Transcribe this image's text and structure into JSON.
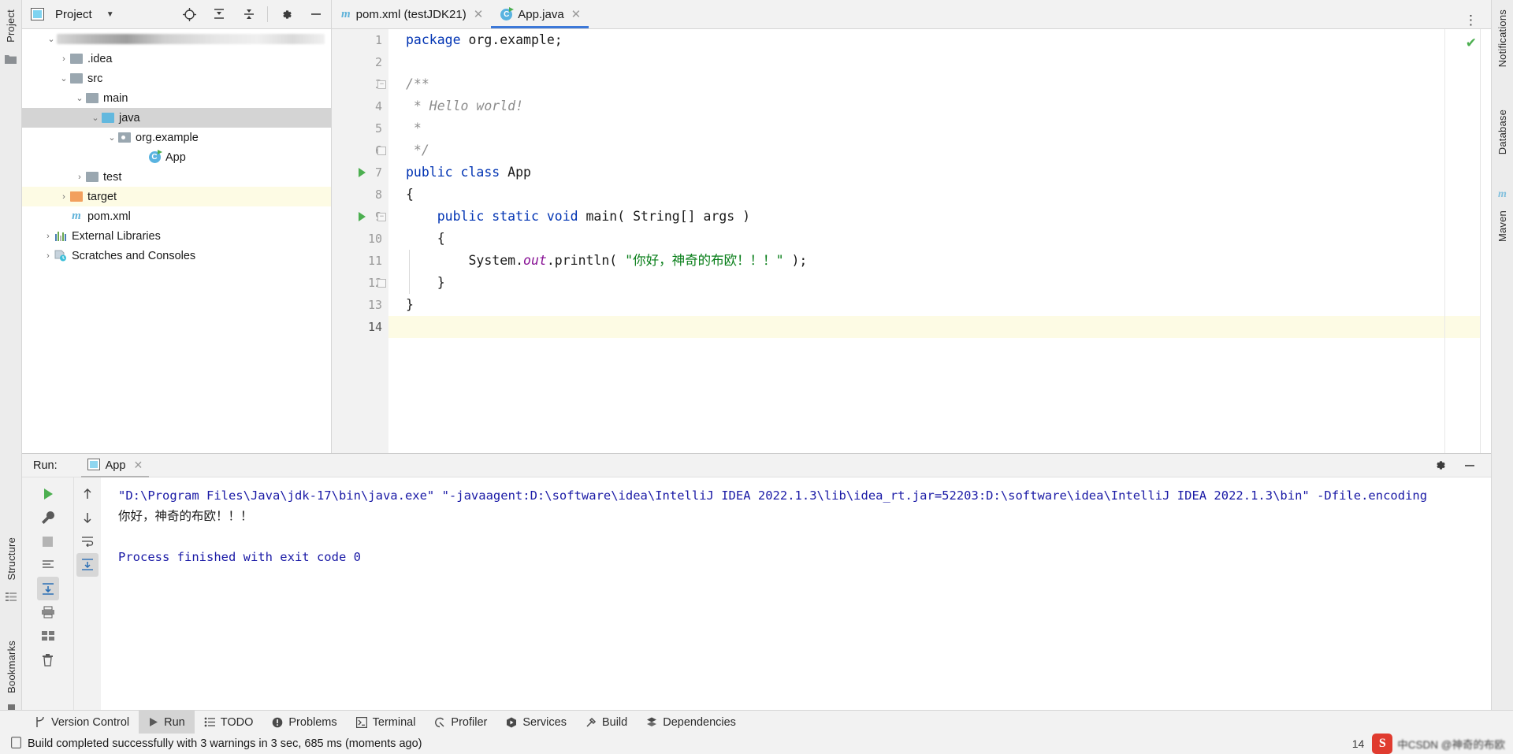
{
  "window": {
    "left_strip": {
      "project_tab": "Project",
      "structure_tab": "Structure",
      "bookmarks_tab": "Bookmarks"
    },
    "right_strip": {
      "notifications_tab": "Notifications",
      "database_tab": "Database",
      "maven_tab": "Maven"
    }
  },
  "project_toolbar": {
    "title": "Project",
    "icons": [
      "project-select-icon",
      "locate-icon",
      "expand-all-icon",
      "collapse-all-icon",
      "settings-gear-icon",
      "minimize-icon"
    ]
  },
  "editor_tabs": [
    {
      "label": "pom.xml (testJDK21)",
      "icon": "maven-file-icon",
      "active": false,
      "closable": true
    },
    {
      "label": "App.java",
      "icon": "java-class-icon",
      "active": true,
      "closable": true
    }
  ],
  "project_tree": [
    {
      "label": "",
      "indent": 0,
      "arrow": "down",
      "icon": "project-root-blurred",
      "blurred": true,
      "state": "normal"
    },
    {
      "label": ".idea",
      "indent": 1,
      "arrow": "right",
      "icon": "folder-gray",
      "state": "normal"
    },
    {
      "label": "src",
      "indent": 1,
      "arrow": "down",
      "icon": "folder-gray",
      "state": "normal"
    },
    {
      "label": "main",
      "indent": 2,
      "arrow": "down",
      "icon": "folder-gray",
      "state": "normal"
    },
    {
      "label": "java",
      "indent": 3,
      "arrow": "down",
      "icon": "folder-source-blue",
      "state": "selected"
    },
    {
      "label": "org.example",
      "indent": 4,
      "arrow": "down",
      "icon": "package-icon",
      "state": "normal"
    },
    {
      "label": "App",
      "indent": 5,
      "arrow": "none",
      "icon": "java-class-icon",
      "state": "normal"
    },
    {
      "label": "test",
      "indent": 2,
      "arrow": "right",
      "icon": "folder-gray",
      "state": "normal"
    },
    {
      "label": "target",
      "indent": 1,
      "arrow": "right",
      "icon": "folder-orange",
      "state": "highlight"
    },
    {
      "label": "pom.xml",
      "indent": 1,
      "arrow": "none",
      "icon": "maven-file-icon",
      "state": "normal"
    },
    {
      "label": "External Libraries",
      "indent": 0,
      "arrow": "right",
      "icon": "libraries-icon",
      "state": "normal"
    },
    {
      "label": "Scratches and Consoles",
      "indent": 0,
      "arrow": "right",
      "icon": "scratches-icon",
      "state": "normal"
    }
  ],
  "editor": {
    "filename": "App.java",
    "inspection_status": "ok-check",
    "lines": [
      {
        "n": "1",
        "tokens": [
          {
            "t": "package ",
            "c": "kw"
          },
          {
            "t": "org.example;",
            "c": "plain"
          }
        ]
      },
      {
        "n": "2",
        "tokens": []
      },
      {
        "n": "3",
        "tokens": [
          {
            "t": "/**",
            "c": "cmt"
          }
        ],
        "fold": "open"
      },
      {
        "n": "4",
        "tokens": [
          {
            "t": " * Hello world!",
            "c": "cmt"
          }
        ]
      },
      {
        "n": "5",
        "tokens": [
          {
            "t": " *",
            "c": "cmt"
          }
        ]
      },
      {
        "n": "6",
        "tokens": [
          {
            "t": " */",
            "c": "cmt"
          }
        ],
        "fold": "end"
      },
      {
        "n": "7",
        "tokens": [
          {
            "t": "public class ",
            "c": "kw"
          },
          {
            "t": "App",
            "c": "plain"
          }
        ],
        "run_marker": true
      },
      {
        "n": "8",
        "tokens": [
          {
            "t": "{",
            "c": "plain"
          }
        ]
      },
      {
        "n": "9",
        "tokens": [
          {
            "t": "    ",
            "c": "plain"
          },
          {
            "t": "public static void ",
            "c": "kw"
          },
          {
            "t": "main( String[] args )",
            "c": "plain"
          }
        ],
        "run_marker": true,
        "fold": "open"
      },
      {
        "n": "10",
        "tokens": [
          {
            "t": "    {",
            "c": "plain"
          }
        ]
      },
      {
        "n": "11",
        "tokens": [
          {
            "t": "        System.",
            "c": "plain"
          },
          {
            "t": "out",
            "c": "fld"
          },
          {
            "t": ".println( ",
            "c": "plain"
          },
          {
            "t": "\"你好，神奇的布欧！！！\"",
            "c": "str"
          },
          {
            "t": " );",
            "c": "plain"
          }
        ]
      },
      {
        "n": "12",
        "tokens": [
          {
            "t": "    }",
            "c": "plain"
          }
        ],
        "fold": "end"
      },
      {
        "n": "13",
        "tokens": [
          {
            "t": "}",
            "c": "plain"
          }
        ]
      },
      {
        "n": "14",
        "tokens": [],
        "active": true
      }
    ]
  },
  "run_panel": {
    "label": "Run:",
    "tab": {
      "label": "App",
      "icon": "run-config-icon",
      "closable": true
    },
    "header_icons": [
      "settings-gear-icon",
      "minimize-icon"
    ],
    "gutter_icons": [
      "rerun-icon",
      "wrench-icon",
      "stop-icon",
      "print-icon-1",
      "download-icon",
      "printer-icon",
      "layout-icon",
      "trash-icon"
    ],
    "nav_icons": [
      "up-arrow-icon",
      "down-arrow-icon",
      "soft-wrap-icon",
      "scroll-to-end-icon"
    ],
    "console_lines": [
      {
        "text": "\"D:\\Program Files\\Java\\jdk-17\\bin\\java.exe\" \"-javaagent:D:\\software\\idea\\IntelliJ IDEA 2022.1.3\\lib\\idea_rt.jar=52203:D:\\software\\idea\\IntelliJ IDEA 2022.1.3\\bin\" -Dfile.encoding",
        "color": "blue"
      },
      {
        "text": "你好，神奇的布欧！！！",
        "color": "black"
      },
      {
        "text": "",
        "color": "black"
      },
      {
        "text": "Process finished with exit code 0",
        "color": "blue"
      }
    ]
  },
  "bottom_tabs": [
    {
      "label": "Version Control",
      "icon": "branch-icon",
      "active": false
    },
    {
      "label": "Run",
      "icon": "play-icon",
      "active": true
    },
    {
      "label": "TODO",
      "icon": "todo-list-icon",
      "active": false
    },
    {
      "label": "Problems",
      "icon": "problems-icon",
      "active": false
    },
    {
      "label": "Terminal",
      "icon": "terminal-icon",
      "active": false
    },
    {
      "label": "Profiler",
      "icon": "profiler-icon",
      "active": false
    },
    {
      "label": "Services",
      "icon": "services-icon",
      "active": false
    },
    {
      "label": "Build",
      "icon": "hammer-icon",
      "active": false
    },
    {
      "label": "Dependencies",
      "icon": "dependencies-icon",
      "active": false
    }
  ],
  "status_bar": {
    "icon": "build-status-icon",
    "message": "Build completed successfully with 3 warnings in 3 sec, 685 ms (moments ago)",
    "line_col": "14",
    "watermark": {
      "logo_letter": "S",
      "text": "中CSDN @神奇的布欧"
    }
  },
  "colors": {
    "accent_blue": "#3c78d8",
    "keyword": "#0033b3",
    "string": "#067d17",
    "comment": "#8c8c8c",
    "field": "#871094",
    "console_blue": "#1a1aa6",
    "selected_row": "#d4d4d4",
    "highlight_row": "#fdfbe4",
    "success_green": "#4caf50"
  }
}
